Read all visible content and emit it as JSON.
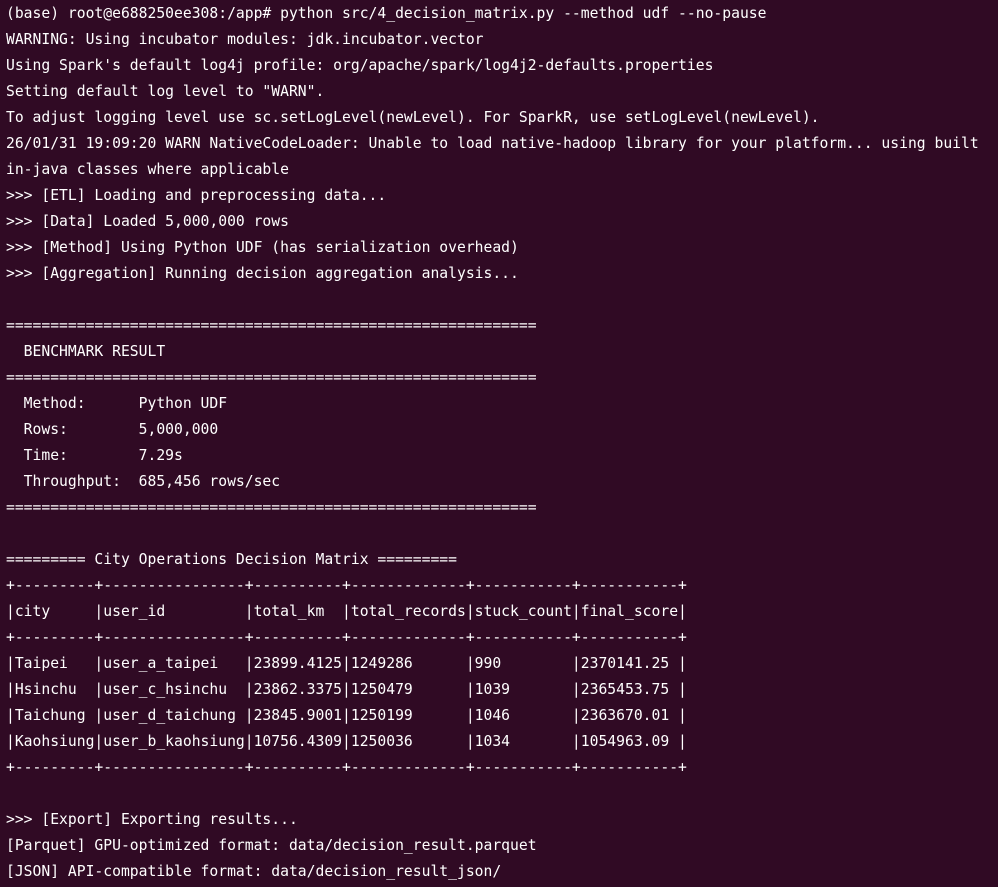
{
  "terminal": {
    "lines": [
      "(base) root@e688250ee308:/app# python src/4_decision_matrix.py --method udf --no-pause",
      "WARNING: Using incubator modules: jdk.incubator.vector",
      "Using Spark's default log4j profile: org/apache/spark/log4j2-defaults.properties",
      "Setting default log level to \"WARN\".",
      "To adjust logging level use sc.setLogLevel(newLevel). For SparkR, use setLogLevel(newLevel).",
      "26/01/31 19:09:20 WARN NativeCodeLoader: Unable to load native-hadoop library for your platform... using built",
      "in-java classes where applicable",
      ">>> [ETL] Loading and preprocessing data...",
      ">>> [Data] Loaded 5,000,000 rows",
      ">>> [Method] Using Python UDF (has serialization overhead)",
      ">>> [Aggregation] Running decision aggregation analysis...",
      "",
      "============================================================",
      "  BENCHMARK RESULT",
      "============================================================",
      "  Method:      Python UDF",
      "  Rows:        5,000,000",
      "  Time:        7.29s",
      "  Throughput:  685,456 rows/sec",
      "============================================================",
      "",
      "========= City Operations Decision Matrix =========",
      "+---------+----------------+----------+-------------+-----------+-----------+",
      "|city     |user_id         |total_km  |total_records|stuck_count|final_score|",
      "+---------+----------------+----------+-------------+-----------+-----------+",
      "|Taipei   |user_a_taipei   |23899.4125|1249286      |990        |2370141.25 |",
      "|Hsinchu  |user_c_hsinchu  |23862.3375|1250479      |1039       |2365453.75 |",
      "|Taichung |user_d_taichung |23845.9001|1250199      |1046       |2363670.01 |",
      "|Kaohsiung|user_b_kaohsiung|10756.4309|1250036      |1034       |1054963.09 |",
      "+---------+----------------+----------+-------------+-----------+-----------+",
      "",
      ">>> [Export] Exporting results...",
      "[Parquet] GPU-optimized format: data/decision_result.parquet",
      "[JSON] API-compatible format: data/decision_result_json/"
    ]
  }
}
